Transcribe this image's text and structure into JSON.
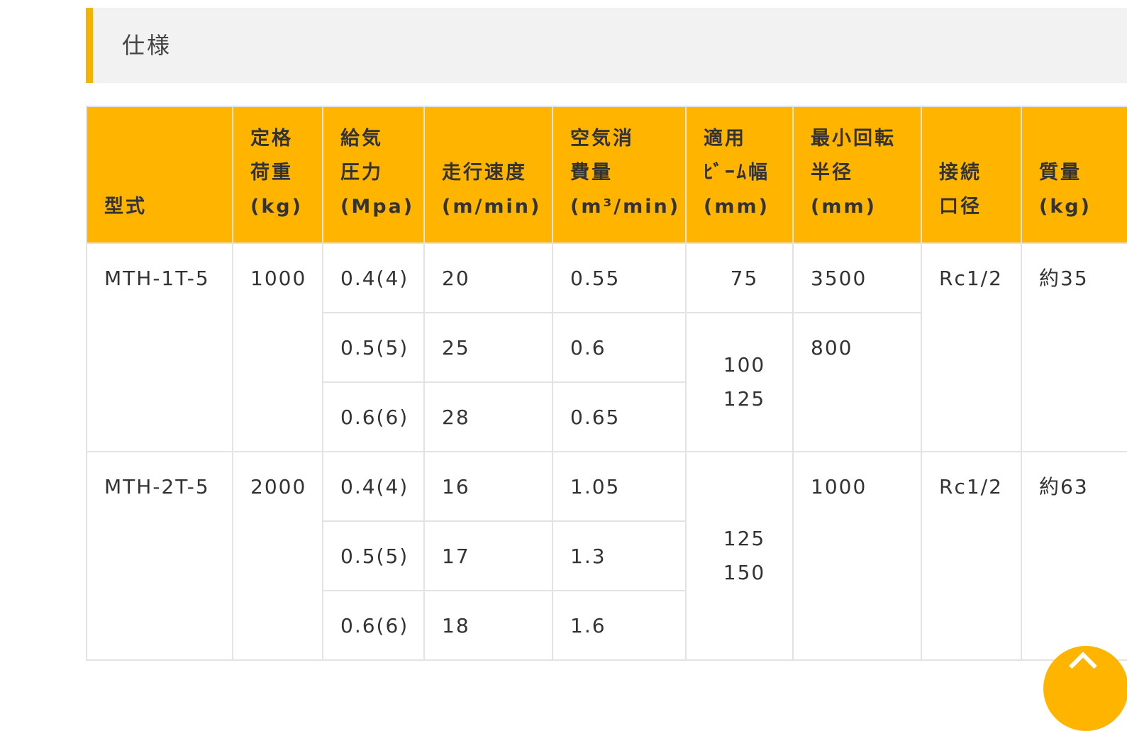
{
  "section": {
    "title": "仕様"
  },
  "table": {
    "headers": [
      "型式",
      "定格\n荷重\n(kg)",
      "給気\n圧力\n(Mpa)",
      "走行速度\n(m/min)",
      "空気消\n費量\n(m³/min)",
      "適用\nﾋﾞｰﾑ幅\n(mm)",
      "最小回転\n半径\n(mm)",
      "接続\n口径",
      "質量\n(kg)"
    ],
    "models": [
      {
        "model": "MTH-1T-5",
        "rated_load": "1000",
        "port": "Rc1/2",
        "mass": "約35",
        "rows": [
          {
            "pressure": "0.4(4)",
            "speed": "20",
            "air": "0.55"
          },
          {
            "pressure": "0.5(5)",
            "speed": "25",
            "air": "0.6"
          },
          {
            "pressure": "0.6(6)",
            "speed": "28",
            "air": "0.65"
          }
        ],
        "beam_widths": [
          "75",
          "100\n125"
        ],
        "turning_radii": [
          "3500",
          "800"
        ]
      },
      {
        "model": "MTH-2T-5",
        "rated_load": "2000",
        "port": "Rc1/2",
        "mass": "約63",
        "rows": [
          {
            "pressure": "0.4(4)",
            "speed": "16",
            "air": "1.05"
          },
          {
            "pressure": "0.5(5)",
            "speed": "17",
            "air": "1.3"
          },
          {
            "pressure": "0.6(6)",
            "speed": "18",
            "air": "1.6"
          }
        ],
        "beam_widths": [
          "125\n150"
        ],
        "turning_radii": [
          "1000"
        ]
      }
    ]
  },
  "scroll_top": {
    "icon": "chevron-up-icon"
  },
  "colors": {
    "accent": "#ffb400",
    "heading_bg": "#f2f2f2",
    "border": "#e3e3e3",
    "text": "#333333"
  }
}
